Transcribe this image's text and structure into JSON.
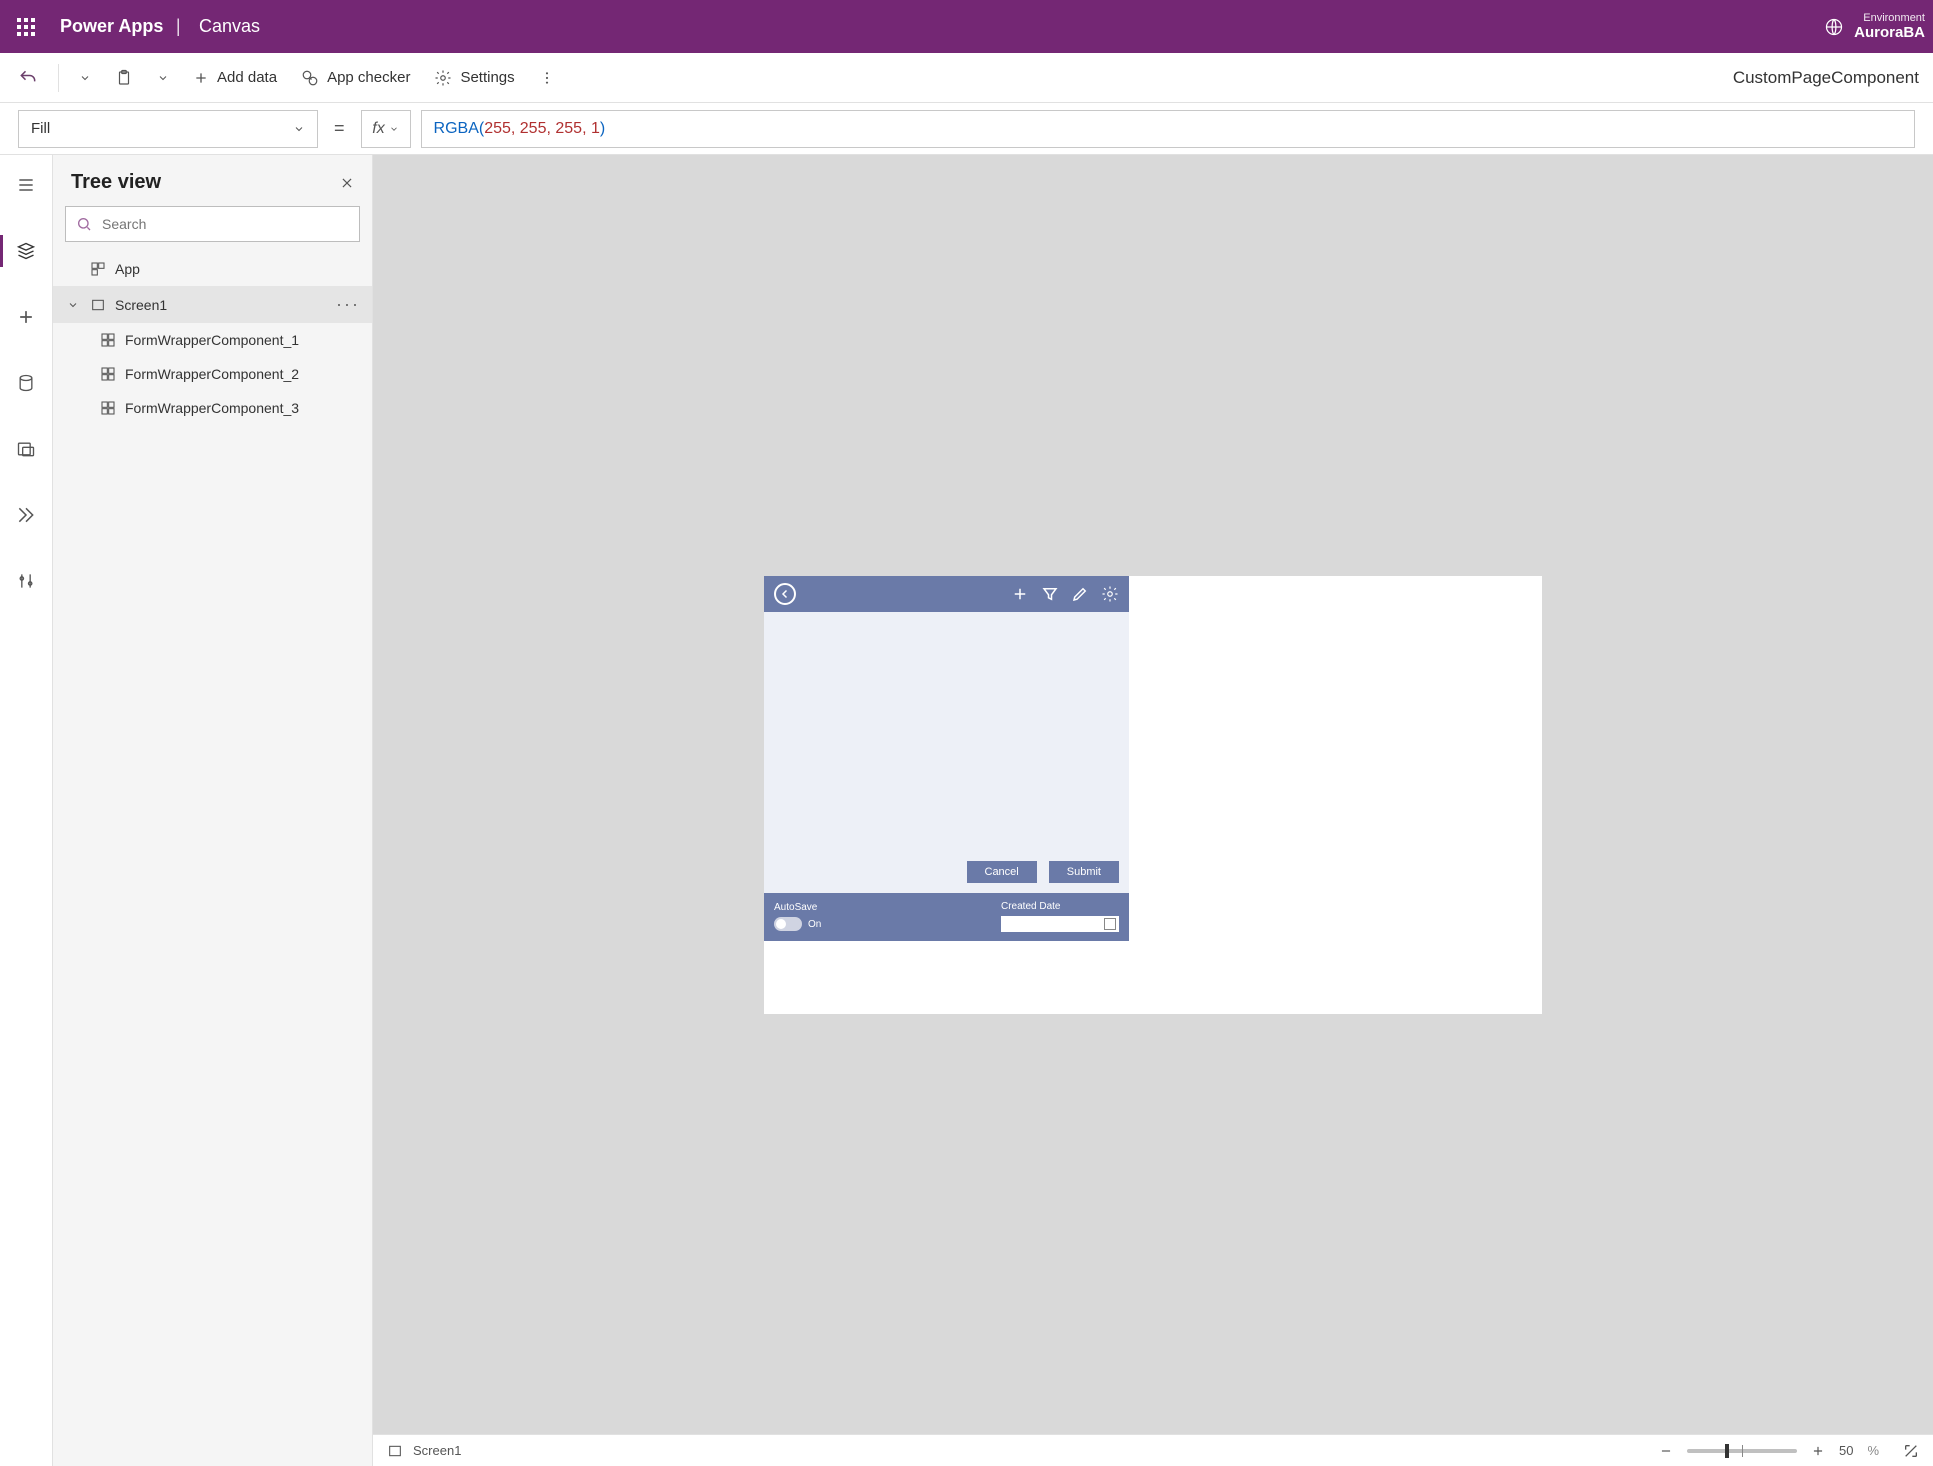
{
  "header": {
    "app_name": "Power Apps",
    "divider": "|",
    "app_sub": "Canvas",
    "env_label": "Environment",
    "env_name": "AuroraBA"
  },
  "toolbar": {
    "add_data": "Add data",
    "app_checker": "App checker",
    "settings": "Settings",
    "right_title": "CustomPageComponent"
  },
  "formula": {
    "property": "Fill",
    "fn": "RGBA",
    "args": [
      "255",
      "255",
      "255",
      "1"
    ]
  },
  "tree": {
    "title": "Tree view",
    "search_placeholder": "Search",
    "items": [
      {
        "label": "App",
        "level": 0,
        "icon": "app",
        "selected": false
      },
      {
        "label": "Screen1",
        "level": 1,
        "icon": "screen",
        "selected": true,
        "expandable": true
      },
      {
        "label": "FormWrapperComponent_1",
        "level": 2,
        "icon": "component",
        "selected": false
      },
      {
        "label": "FormWrapperComponent_2",
        "level": 2,
        "icon": "component",
        "selected": false
      },
      {
        "label": "FormWrapperComponent_3",
        "level": 2,
        "icon": "component",
        "selected": false
      }
    ]
  },
  "canvas": {
    "component": {
      "buttons": {
        "cancel": "Cancel",
        "submit": "Submit"
      },
      "footer": {
        "autosave_label": "AutoSave",
        "autosave_value": "On",
        "created_label": "Created Date"
      }
    }
  },
  "status": {
    "screen": "Screen1",
    "zoom_value": "50",
    "zoom_pct": "%"
  },
  "colors": {
    "brand": "#742774",
    "comp_accent": "#6a7aa8"
  }
}
